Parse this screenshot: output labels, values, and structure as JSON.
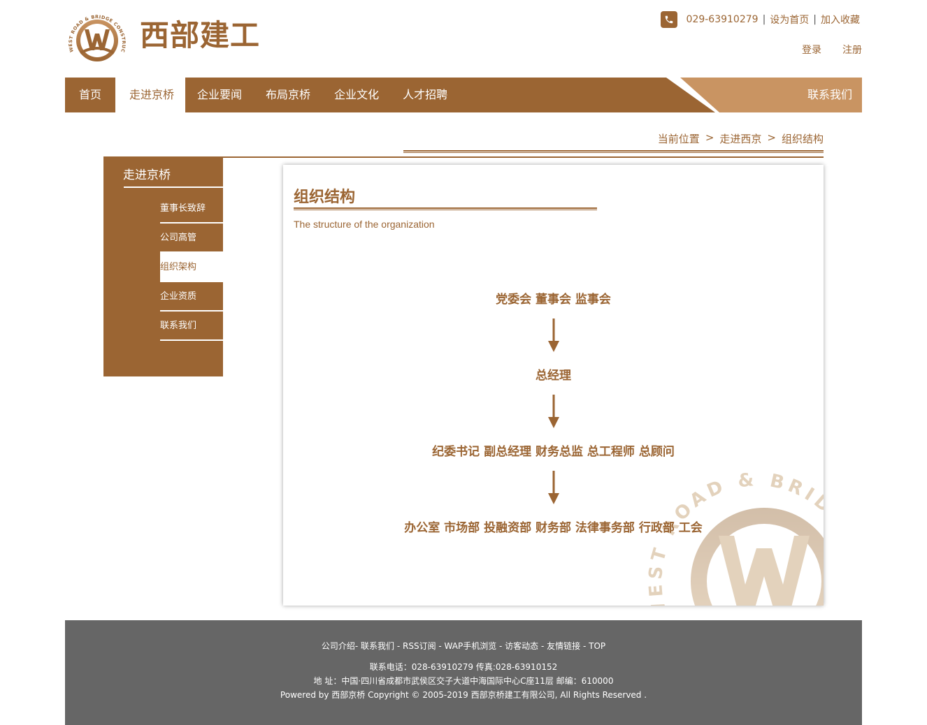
{
  "brand": {
    "logo_ring_text": "WEST ROAD & BRIDGE CONSTRUCTION",
    "name": "西部建工"
  },
  "topbar": {
    "phone": "029-63910279",
    "set_home": "设为首页",
    "add_fav": "加入收藏",
    "login": "登录",
    "register": "注册"
  },
  "nav": {
    "items": [
      {
        "label": "首页"
      },
      {
        "label": "走进京桥"
      },
      {
        "label": "企业要闻"
      },
      {
        "label": "布局京桥"
      },
      {
        "label": "企业文化"
      },
      {
        "label": "人才招聘"
      }
    ],
    "contact": "联系我们",
    "colors": {
      "primary": "#9b6533",
      "accent": "#c99462"
    }
  },
  "breadcrumb": {
    "label": "当前位置",
    "items": [
      "走进西京",
      "组织结构"
    ]
  },
  "sidebar": {
    "title": "走进京桥",
    "items": [
      {
        "label": "董事长致辞"
      },
      {
        "label": "公司高管"
      },
      {
        "label": "组织架构"
      },
      {
        "label": "企业资质"
      },
      {
        "label": "联系我们"
      }
    ]
  },
  "content": {
    "title": "组织结构",
    "subtitle": "The structure of the organization",
    "org": [
      "党委会 董事会 监事会",
      "总经理",
      "纪委书记 副总经理 财务总监 总工程师 总顾问",
      "办公室 市场部 投融资部 财务部 法律事务部 行政部 工会"
    ]
  },
  "footer": {
    "links": [
      "公司介绍",
      "联系我们",
      "RSS订阅",
      "WAP手机浏览",
      "访客动态",
      "友情链接",
      "TOP"
    ],
    "phone": "联系电话：028-63910279 传真:028-63910152",
    "address": "地 址：中国·四川省成都市武侯区交子大道中海国际中心C座11层 邮编：610000",
    "copyright": "Powered by 西部京桥 Copyright © 2005-2019 西部京桥建工有限公司, All Rights Reserved ."
  }
}
